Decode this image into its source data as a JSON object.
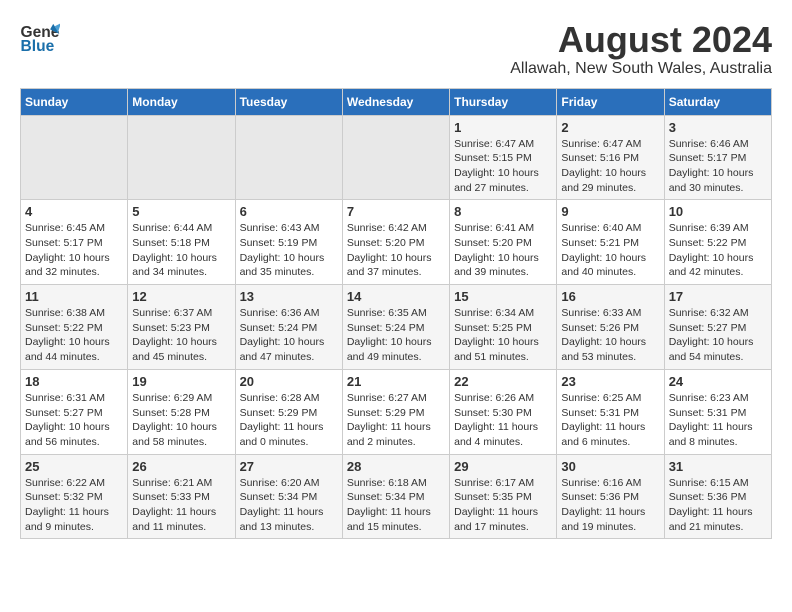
{
  "header": {
    "logo_general": "General",
    "logo_blue": "Blue",
    "title": "August 2024",
    "subtitle": "Allawah, New South Wales, Australia"
  },
  "weekdays": [
    "Sunday",
    "Monday",
    "Tuesday",
    "Wednesday",
    "Thursday",
    "Friday",
    "Saturday"
  ],
  "weeks": [
    [
      {
        "day": "",
        "sunrise": "",
        "sunset": "",
        "daylight": ""
      },
      {
        "day": "",
        "sunrise": "",
        "sunset": "",
        "daylight": ""
      },
      {
        "day": "",
        "sunrise": "",
        "sunset": "",
        "daylight": ""
      },
      {
        "day": "",
        "sunrise": "",
        "sunset": "",
        "daylight": ""
      },
      {
        "day": "1",
        "sunrise": "Sunrise: 6:47 AM",
        "sunset": "Sunset: 5:15 PM",
        "daylight": "Daylight: 10 hours and 27 minutes."
      },
      {
        "day": "2",
        "sunrise": "Sunrise: 6:47 AM",
        "sunset": "Sunset: 5:16 PM",
        "daylight": "Daylight: 10 hours and 29 minutes."
      },
      {
        "day": "3",
        "sunrise": "Sunrise: 6:46 AM",
        "sunset": "Sunset: 5:17 PM",
        "daylight": "Daylight: 10 hours and 30 minutes."
      }
    ],
    [
      {
        "day": "4",
        "sunrise": "Sunrise: 6:45 AM",
        "sunset": "Sunset: 5:17 PM",
        "daylight": "Daylight: 10 hours and 32 minutes."
      },
      {
        "day": "5",
        "sunrise": "Sunrise: 6:44 AM",
        "sunset": "Sunset: 5:18 PM",
        "daylight": "Daylight: 10 hours and 34 minutes."
      },
      {
        "day": "6",
        "sunrise": "Sunrise: 6:43 AM",
        "sunset": "Sunset: 5:19 PM",
        "daylight": "Daylight: 10 hours and 35 minutes."
      },
      {
        "day": "7",
        "sunrise": "Sunrise: 6:42 AM",
        "sunset": "Sunset: 5:20 PM",
        "daylight": "Daylight: 10 hours and 37 minutes."
      },
      {
        "day": "8",
        "sunrise": "Sunrise: 6:41 AM",
        "sunset": "Sunset: 5:20 PM",
        "daylight": "Daylight: 10 hours and 39 minutes."
      },
      {
        "day": "9",
        "sunrise": "Sunrise: 6:40 AM",
        "sunset": "Sunset: 5:21 PM",
        "daylight": "Daylight: 10 hours and 40 minutes."
      },
      {
        "day": "10",
        "sunrise": "Sunrise: 6:39 AM",
        "sunset": "Sunset: 5:22 PM",
        "daylight": "Daylight: 10 hours and 42 minutes."
      }
    ],
    [
      {
        "day": "11",
        "sunrise": "Sunrise: 6:38 AM",
        "sunset": "Sunset: 5:22 PM",
        "daylight": "Daylight: 10 hours and 44 minutes."
      },
      {
        "day": "12",
        "sunrise": "Sunrise: 6:37 AM",
        "sunset": "Sunset: 5:23 PM",
        "daylight": "Daylight: 10 hours and 45 minutes."
      },
      {
        "day": "13",
        "sunrise": "Sunrise: 6:36 AM",
        "sunset": "Sunset: 5:24 PM",
        "daylight": "Daylight: 10 hours and 47 minutes."
      },
      {
        "day": "14",
        "sunrise": "Sunrise: 6:35 AM",
        "sunset": "Sunset: 5:24 PM",
        "daylight": "Daylight: 10 hours and 49 minutes."
      },
      {
        "day": "15",
        "sunrise": "Sunrise: 6:34 AM",
        "sunset": "Sunset: 5:25 PM",
        "daylight": "Daylight: 10 hours and 51 minutes."
      },
      {
        "day": "16",
        "sunrise": "Sunrise: 6:33 AM",
        "sunset": "Sunset: 5:26 PM",
        "daylight": "Daylight: 10 hours and 53 minutes."
      },
      {
        "day": "17",
        "sunrise": "Sunrise: 6:32 AM",
        "sunset": "Sunset: 5:27 PM",
        "daylight": "Daylight: 10 hours and 54 minutes."
      }
    ],
    [
      {
        "day": "18",
        "sunrise": "Sunrise: 6:31 AM",
        "sunset": "Sunset: 5:27 PM",
        "daylight": "Daylight: 10 hours and 56 minutes."
      },
      {
        "day": "19",
        "sunrise": "Sunrise: 6:29 AM",
        "sunset": "Sunset: 5:28 PM",
        "daylight": "Daylight: 10 hours and 58 minutes."
      },
      {
        "day": "20",
        "sunrise": "Sunrise: 6:28 AM",
        "sunset": "Sunset: 5:29 PM",
        "daylight": "Daylight: 11 hours and 0 minutes."
      },
      {
        "day": "21",
        "sunrise": "Sunrise: 6:27 AM",
        "sunset": "Sunset: 5:29 PM",
        "daylight": "Daylight: 11 hours and 2 minutes."
      },
      {
        "day": "22",
        "sunrise": "Sunrise: 6:26 AM",
        "sunset": "Sunset: 5:30 PM",
        "daylight": "Daylight: 11 hours and 4 minutes."
      },
      {
        "day": "23",
        "sunrise": "Sunrise: 6:25 AM",
        "sunset": "Sunset: 5:31 PM",
        "daylight": "Daylight: 11 hours and 6 minutes."
      },
      {
        "day": "24",
        "sunrise": "Sunrise: 6:23 AM",
        "sunset": "Sunset: 5:31 PM",
        "daylight": "Daylight: 11 hours and 8 minutes."
      }
    ],
    [
      {
        "day": "25",
        "sunrise": "Sunrise: 6:22 AM",
        "sunset": "Sunset: 5:32 PM",
        "daylight": "Daylight: 11 hours and 9 minutes."
      },
      {
        "day": "26",
        "sunrise": "Sunrise: 6:21 AM",
        "sunset": "Sunset: 5:33 PM",
        "daylight": "Daylight: 11 hours and 11 minutes."
      },
      {
        "day": "27",
        "sunrise": "Sunrise: 6:20 AM",
        "sunset": "Sunset: 5:34 PM",
        "daylight": "Daylight: 11 hours and 13 minutes."
      },
      {
        "day": "28",
        "sunrise": "Sunrise: 6:18 AM",
        "sunset": "Sunset: 5:34 PM",
        "daylight": "Daylight: 11 hours and 15 minutes."
      },
      {
        "day": "29",
        "sunrise": "Sunrise: 6:17 AM",
        "sunset": "Sunset: 5:35 PM",
        "daylight": "Daylight: 11 hours and 17 minutes."
      },
      {
        "day": "30",
        "sunrise": "Sunrise: 6:16 AM",
        "sunset": "Sunset: 5:36 PM",
        "daylight": "Daylight: 11 hours and 19 minutes."
      },
      {
        "day": "31",
        "sunrise": "Sunrise: 6:15 AM",
        "sunset": "Sunset: 5:36 PM",
        "daylight": "Daylight: 11 hours and 21 minutes."
      }
    ]
  ]
}
